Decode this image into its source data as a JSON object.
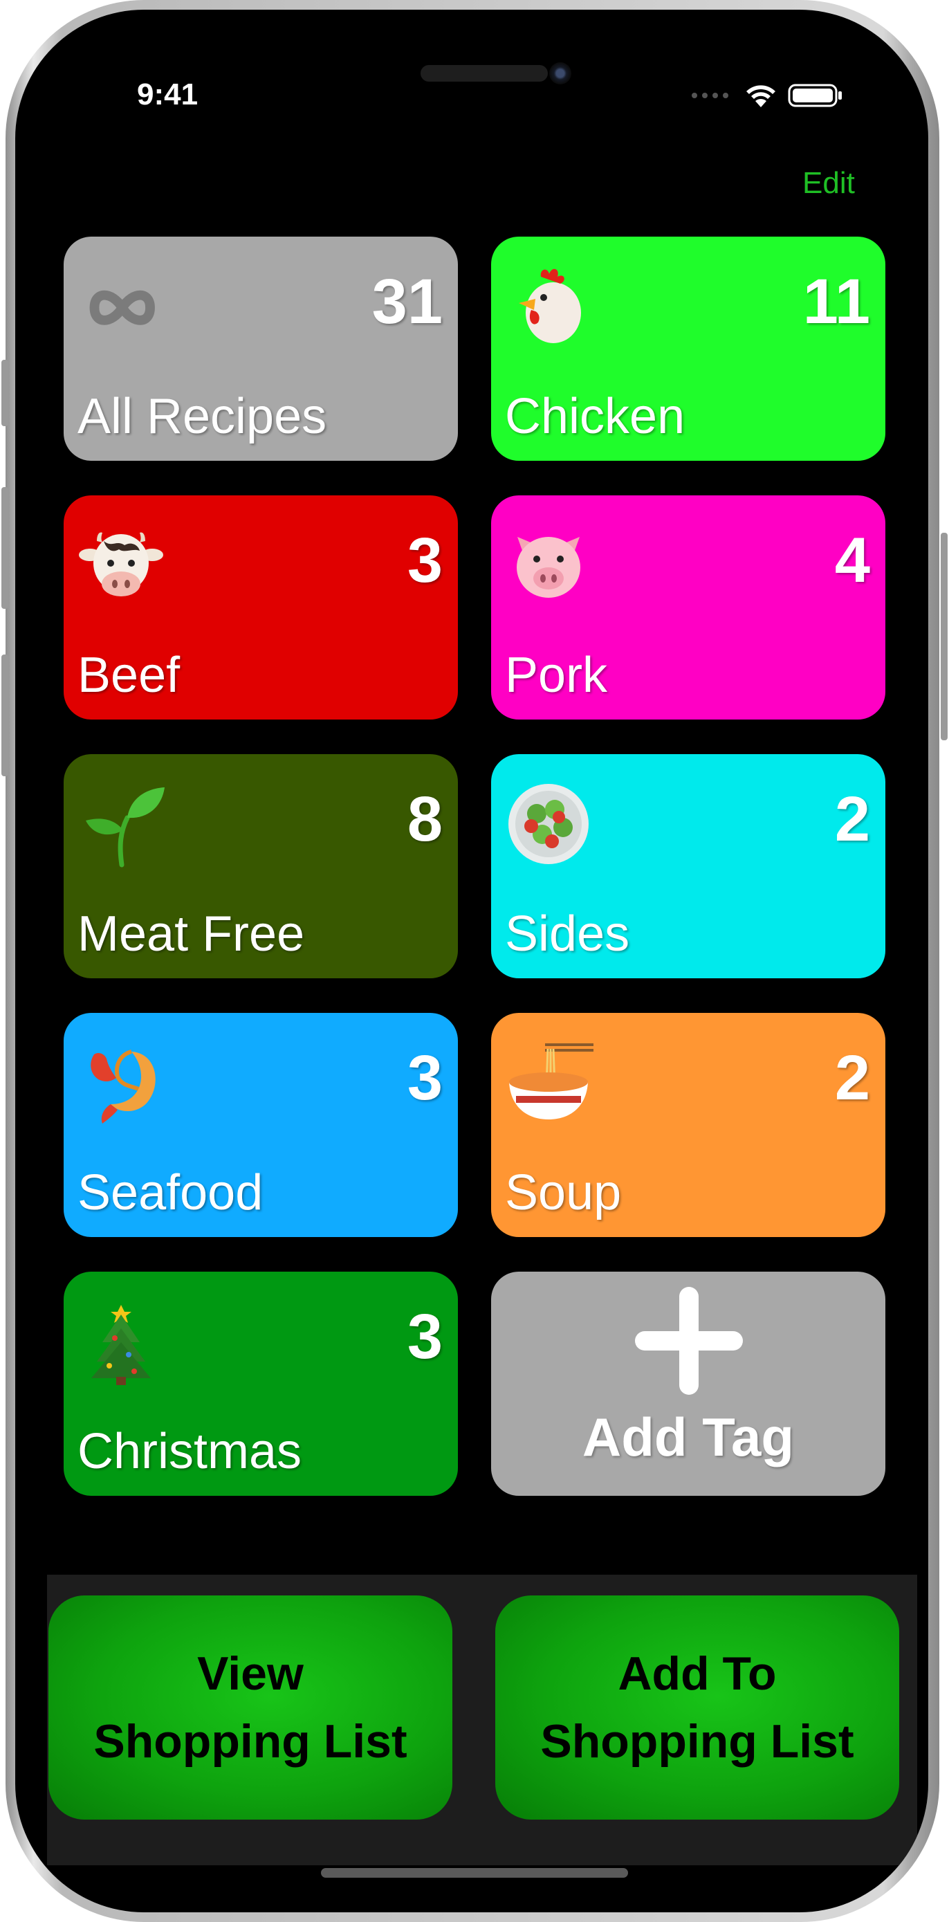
{
  "status_bar": {
    "time": "9:41"
  },
  "header": {
    "edit_label": "Edit"
  },
  "tiles": [
    {
      "label": "All Recipes",
      "count": "31",
      "icon": "infinity-icon",
      "color": "#a8a8a8"
    },
    {
      "label": "Chicken",
      "count": "11",
      "icon": "chicken-icon",
      "color": "#1ffd2b"
    },
    {
      "label": "Beef",
      "count": "3",
      "icon": "cow-face-icon",
      "color": "#e00000"
    },
    {
      "label": "Pork",
      "count": "4",
      "icon": "pig-face-icon",
      "color": "#ff00c4"
    },
    {
      "label": "Meat Free",
      "count": "8",
      "icon": "seedling-icon",
      "color": "#385800"
    },
    {
      "label": "Sides",
      "count": "2",
      "icon": "salad-icon",
      "color": "#00eaec"
    },
    {
      "label": "Seafood",
      "count": "3",
      "icon": "shrimp-icon",
      "color": "#10abff"
    },
    {
      "label": "Soup",
      "count": "2",
      "icon": "noodle-bowl-icon",
      "color": "#ff9633"
    },
    {
      "label": "Christmas",
      "count": "3",
      "icon": "christmas-tree-icon",
      "color": "#009912"
    }
  ],
  "add_tag": {
    "label": "Add Tag",
    "icon": "plus-icon",
    "color": "#a8a8a8"
  },
  "actions": {
    "view_shopping_list": {
      "line1": "View",
      "line2": "Shopping List"
    },
    "add_to_shopping_list": {
      "line1": "Add To",
      "line2": "Shopping List"
    }
  },
  "colors": {
    "accent": "#1fbf25",
    "button_green": "#0ea30e",
    "background": "#000000"
  }
}
